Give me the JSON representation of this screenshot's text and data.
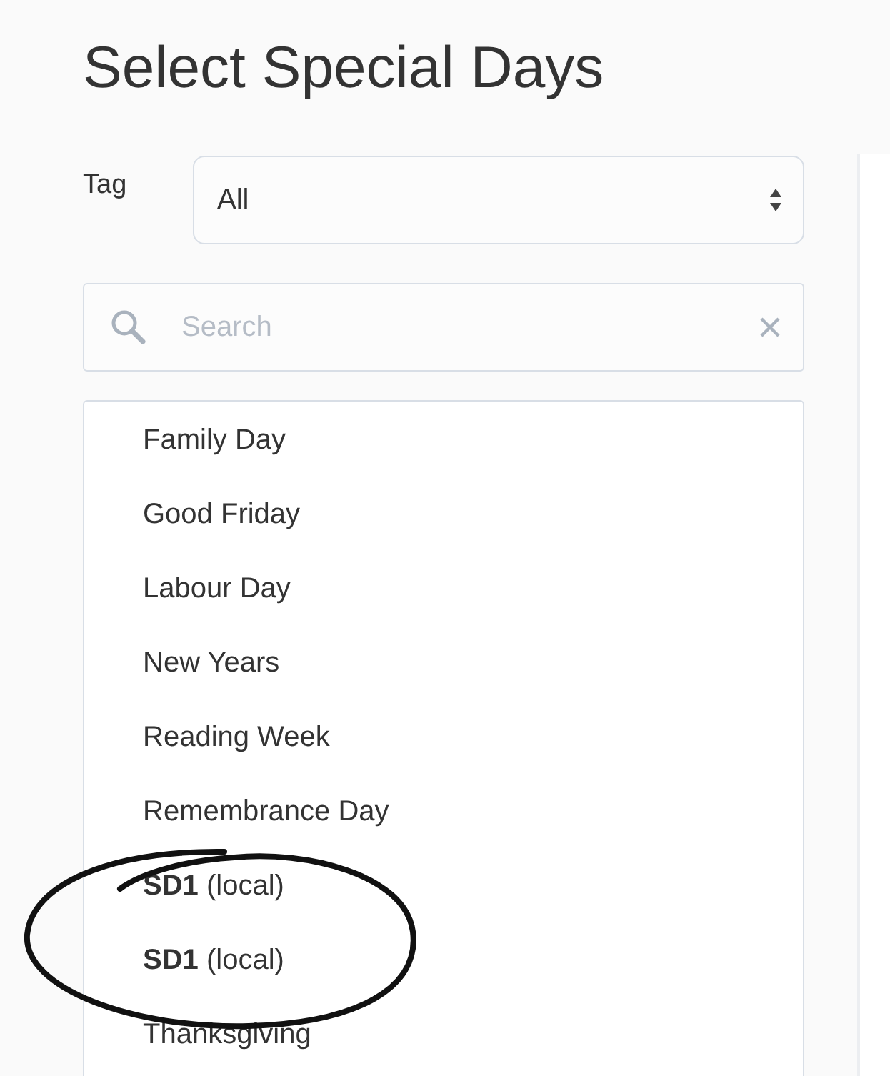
{
  "title": "Select Special Days",
  "tag_filter": {
    "label": "Tag",
    "value": "All"
  },
  "search": {
    "placeholder": "Search"
  },
  "days": [
    {
      "label": "Family Day"
    },
    {
      "label": "Good Friday"
    },
    {
      "label": "Labour Day"
    },
    {
      "label": "New Years"
    },
    {
      "label": "Reading Week"
    },
    {
      "label": "Remembrance Day"
    },
    {
      "label": "**SD1** (local)"
    },
    {
      "label": "**SD1** (local)"
    },
    {
      "label": "Thanksgiving"
    }
  ]
}
